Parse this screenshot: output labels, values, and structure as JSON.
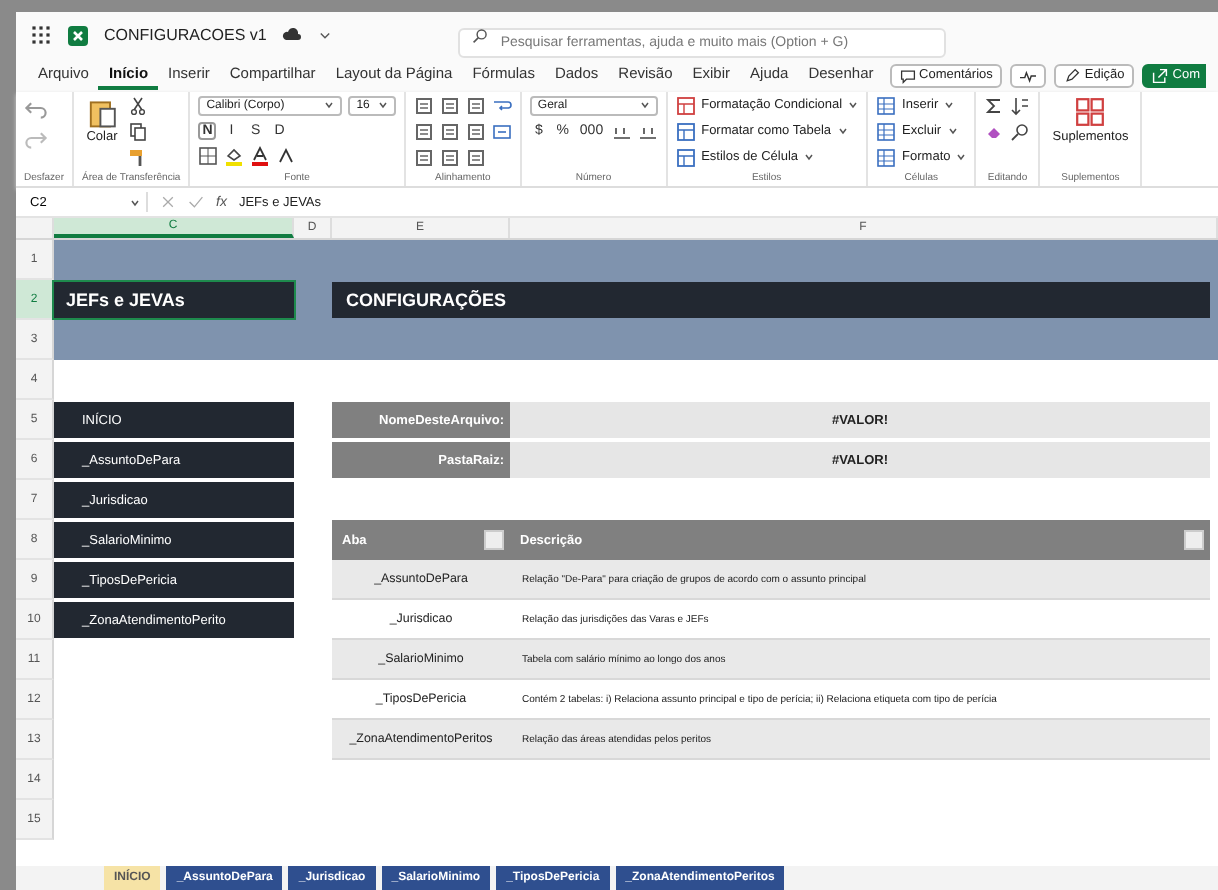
{
  "app": {
    "title": "CONFIGURACOES v1",
    "search": {
      "placeholder": "Pesquisar ferramentas, ajuda e muito mais (Option + G)"
    }
  },
  "menu": [
    {
      "label": "Arquivo",
      "selected": false
    },
    {
      "label": "Início",
      "selected": true
    },
    {
      "label": "Inserir",
      "selected": false
    },
    {
      "label": "Compartilhar",
      "selected": false
    },
    {
      "label": "Layout da Página",
      "selected": false
    },
    {
      "label": "Fórmulas",
      "selected": false
    },
    {
      "label": "Dados",
      "selected": false
    },
    {
      "label": "Revisão",
      "selected": false
    },
    {
      "label": "Exibir",
      "selected": false
    },
    {
      "label": "Ajuda",
      "selected": false
    },
    {
      "label": "Desenhar",
      "selected": false
    }
  ],
  "actions": [
    {
      "kind": "comments",
      "label": "Comentários"
    },
    {
      "kind": "activity"
    },
    {
      "kind": "edit",
      "label": "Edição"
    },
    {
      "kind": "share",
      "label": "Com"
    }
  ],
  "ribbon": [
    {
      "kind": "undo",
      "label": "Desfazer"
    },
    {
      "kind": "clipboard",
      "label": "Área de Transferência",
      "controls": [
        {
          "kind": "large",
          "label": "Colar"
        }
      ]
    },
    {
      "kind": "font",
      "label": "Fonte",
      "controls": [
        {
          "kind": "select",
          "label": "Calibri (Corpo)"
        },
        {
          "kind": "select",
          "label": "16"
        },
        {
          "kind": "key",
          "label": "N"
        },
        {
          "kind": "key",
          "label": "I"
        },
        {
          "kind": "key",
          "label": "S"
        },
        {
          "kind": "key",
          "label": "D"
        }
      ]
    },
    {
      "kind": "align",
      "label": "Alinhamento"
    },
    {
      "kind": "number",
      "label": "Número",
      "controls": [
        {
          "kind": "select",
          "label": "Geral"
        },
        {
          "kind": "key",
          "label": "$"
        },
        {
          "kind": "key",
          "label": "%"
        },
        {
          "kind": "key",
          "label": "000"
        }
      ]
    },
    {
      "kind": "styles",
      "label": "Estilos",
      "controls": [
        {
          "kind": "row",
          "label": "Formatação Condicional"
        },
        {
          "kind": "row",
          "label": "Formatar como Tabela"
        },
        {
          "kind": "row",
          "label": "Estilos de Célula"
        }
      ]
    },
    {
      "kind": "cells",
      "label": "Células",
      "controls": [
        {
          "kind": "row",
          "label": "Inserir"
        },
        {
          "kind": "row",
          "label": "Excluir"
        },
        {
          "kind": "row",
          "label": "Formato"
        }
      ]
    },
    {
      "kind": "editing",
      "label": "Editando"
    },
    {
      "kind": "addins",
      "label": "Suplementos",
      "controls": [
        {
          "kind": "large",
          "label": "Suplementos"
        }
      ]
    }
  ],
  "formula_bar": {
    "cell": "C2",
    "function_label": "fx",
    "value": "JEFs e JEVAs"
  },
  "columns": [
    "C",
    "D",
    "E",
    "F"
  ],
  "rows": [
    "1",
    "2",
    "3",
    "4",
    "5",
    "6",
    "7",
    "8",
    "9",
    "10",
    "11",
    "12",
    "13",
    "14",
    "15"
  ],
  "sheet": {
    "side_title": "JEFs e JEVAs",
    "title": "CONFIGURAÇÕES",
    "nav": [
      "INÍCIO",
      "_AssuntoDePara",
      "_Jurisdicao",
      "_SalarioMinimo",
      "_TiposDePericia",
      "_ZonaAtendimentoPerito"
    ],
    "info": [
      {
        "label": "NomeDesteArquivo:",
        "value": "#VALOR!"
      },
      {
        "label": "PastaRaiz:",
        "value": "#VALOR!"
      }
    ],
    "table": {
      "columns": [
        "Aba",
        "Descrição"
      ],
      "rows": [
        {
          "aba": "_AssuntoDePara",
          "descricao": "Relação \"De-Para\" para criação de grupos de acordo com o assunto principal"
        },
        {
          "aba": "_Jurisdicao",
          "descricao": "Relação das jurisdições das Varas e JEFs"
        },
        {
          "aba": "_SalarioMinimo",
          "descricao": "Tabela com salário mínimo ao longo dos anos"
        },
        {
          "aba": "_TiposDePericia",
          "descricao": "Contém 2 tabelas: i) Relaciona assunto principal e tipo de perícia; ii) Relaciona etiqueta com tipo de perícia"
        },
        {
          "aba": "_ZonaAtendimentoPeritos",
          "descricao": "Relação das áreas atendidas pelos peritos"
        }
      ]
    }
  },
  "sheet_tabs": [
    {
      "label": "INÍCIO",
      "selected": true
    },
    {
      "label": "_AssuntoDePara",
      "selected": false
    },
    {
      "label": "_Jurisdicao",
      "selected": false
    },
    {
      "label": "_SalarioMinimo",
      "selected": false
    },
    {
      "label": "_TiposDePericia",
      "selected": false
    },
    {
      "label": "_ZonaAtendimentoPeritos",
      "selected": false
    }
  ]
}
